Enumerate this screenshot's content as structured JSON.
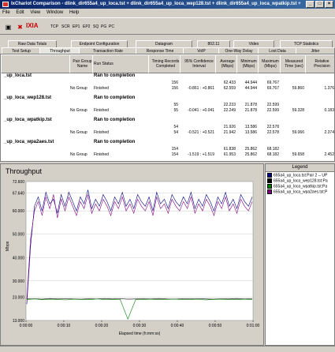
{
  "window": {
    "title": "IxChariot Comparison - dlink_dir655a4_up_loca.tst + dlink_dir655a4_up_loca_wep128.tst + dlink_dir655a4_up_loca_wpatkip.tst +"
  },
  "menu": [
    "File",
    "Edit",
    "View",
    "Window",
    "Help"
  ],
  "toolbar": {
    "logo": "IXIA",
    "labels": [
      "TCP",
      "SCR",
      "EP1",
      "EP2",
      "SQ",
      "PG",
      "PC"
    ]
  },
  "tabs_row1": [
    "Raw Data Totals",
    "Endpoint Configuration",
    "Datagram",
    "802.11",
    "Video",
    "TCP Statistics"
  ],
  "tabs_row2": [
    "Test Setup",
    "Throughput",
    "Transaction Rate",
    "Response Time",
    "VoIP",
    "One-Way Delay",
    "Lost Data",
    "Jitter"
  ],
  "grid": {
    "headers": [
      "Pair Group Name",
      "Run Status",
      "Timing Records Completed",
      "95% Confidence Interval",
      "Average (Mbps)",
      "Minimum (Mbps)",
      "Maximum (Mbps)",
      "Measured Time (sec)",
      "Relative Precision"
    ],
    "rows": [
      {
        "name": "_up_loca.tst",
        "status": "Ran to completion",
        "records": "156",
        "avg": "62.433",
        "min": "44.944",
        "max": "69.767",
        "group": "No Group",
        "sub_status": "Finished",
        "sub_records": "156",
        "ci": "-0.861 : +0.861",
        "sub_avg": "62.559",
        "sub_min": "44.944",
        "sub_max": "69.767",
        "time": "59.860",
        "prec": "1.376"
      },
      {
        "name": "_up_loca_wep128.tst",
        "status": "Ran to completion",
        "records": "55",
        "avg": "22.233",
        "min": "21.878",
        "max": "22.599",
        "group": "No Group",
        "sub_status": "Finished",
        "sub_records": "55",
        "ci": "-0.041 : +0.041",
        "sub_avg": "22.249",
        "sub_min": "21.878",
        "sub_max": "22.599",
        "time": "59.328",
        "prec": "0.183"
      },
      {
        "name": "_up_loca_wpatkip.tst",
        "status": "Ran to completion",
        "records": "54",
        "avg": "21.926",
        "min": "13.586",
        "max": "22.578",
        "group": "No Group",
        "sub_status": "Finished",
        "sub_records": "54",
        "ci": "-0.521 : +0.521",
        "sub_avg": "21.942",
        "sub_min": "13.586",
        "sub_max": "22.578",
        "time": "59.066",
        "prec": "2.374"
      },
      {
        "name": "_up_loca_wpa2aes.tst",
        "status": "Ran to completion",
        "records": "154",
        "avg": "61.838",
        "min": "25.862",
        "max": "68.182",
        "group": "No Group",
        "sub_status": "Finished",
        "sub_records": "154",
        "ci": "-1.519 : +1.519",
        "sub_avg": "61.953",
        "sub_min": "25.862",
        "sub_max": "68.182",
        "time": "59.658",
        "prec": "2.452"
      }
    ]
  },
  "legend": {
    "title": "Legend",
    "items": [
      {
        "label": "655a4_up_loca.tst:Pair 2 -- UP",
        "color": "#000080"
      },
      {
        "label": "655a4_up_loca_wep128.tst:Pa",
        "color": "#000000"
      },
      {
        "label": "655a4_up_loca_wpatkip.tst:Pa",
        "color": "#008000"
      },
      {
        "label": "655a4_up_loca_wpa2aes.tst:P",
        "color": "#800080"
      }
    ]
  },
  "chart_data": {
    "type": "line",
    "title": "Throughput",
    "xlabel": "Elapsed time (h:mm:ss)",
    "ylabel": "Mbps",
    "ylim": [
      13.0,
      72.6
    ],
    "yticks": [
      "72.600",
      "67.640",
      "60.000",
      "50.000",
      "40.000",
      "30.000",
      "23.000",
      "13.000"
    ],
    "xticks": [
      "0:00:00",
      "0:00:10",
      "0:00:20",
      "0:00:30",
      "0:00:40",
      "0:00:50",
      "0:01:00"
    ],
    "series": [
      {
        "name": "655a4_up_loca.tst:Pair 2 -- UP",
        "color": "#000080",
        "values": [
          20,
          45,
          62,
          66,
          60,
          68,
          63,
          65,
          59,
          67,
          62,
          68,
          64,
          60,
          66,
          63,
          69,
          61,
          65,
          62,
          67,
          64,
          60,
          66,
          63,
          68,
          62,
          65,
          61,
          67,
          64,
          62,
          66,
          60,
          68,
          63,
          65,
          61,
          67,
          64,
          62,
          66,
          63,
          68,
          61,
          65,
          62,
          67,
          64,
          60,
          66,
          63,
          68,
          62,
          65,
          61,
          67,
          64,
          62,
          66
        ]
      },
      {
        "name": "655a4_up_loca_wpa2aes.tst:P",
        "color": "#800080",
        "values": [
          22,
          48,
          60,
          64,
          58,
          66,
          61,
          67,
          57,
          65,
          60,
          66,
          62,
          58,
          64,
          61,
          67,
          59,
          63,
          60,
          65,
          62,
          58,
          64,
          61,
          66,
          60,
          63,
          59,
          65,
          62,
          60,
          64,
          58,
          66,
          61,
          63,
          59,
          65,
          62,
          60,
          64,
          61,
          66,
          59,
          63,
          60,
          65,
          62,
          58,
          64,
          61,
          66,
          60,
          63,
          59,
          65,
          62,
          60,
          64
        ]
      },
      {
        "name": "655a4_up_loca_wep128.tst:Pa",
        "color": "#000000",
        "values": [
          22.2,
          22.3,
          22.1,
          22.4,
          22.2,
          22.3,
          22.2,
          22.1,
          22.3,
          22.2,
          22.4,
          22.2,
          22.3,
          22.1,
          22.2,
          22.3,
          22.2,
          22.4,
          22.2,
          22.1,
          22.3,
          22.2,
          22.3,
          22.2,
          22.1,
          22.3,
          22.2,
          22.4,
          22.2,
          22.3
        ]
      },
      {
        "name": "655a4_up_loca_wpatkip.tst:Pa",
        "color": "#008000",
        "values": [
          22.0,
          22.2,
          21.9,
          22.1,
          22.0,
          21.8,
          22.1,
          22.0,
          21.9,
          22.2,
          22.0,
          21.9,
          22.1,
          13.6,
          21.9,
          22.0,
          22.1,
          21.9,
          22.0,
          22.2,
          21.9,
          22.0,
          22.1,
          21.8,
          22.0,
          22.1,
          21.9,
          22.0,
          22.1,
          21.9
        ]
      }
    ]
  }
}
